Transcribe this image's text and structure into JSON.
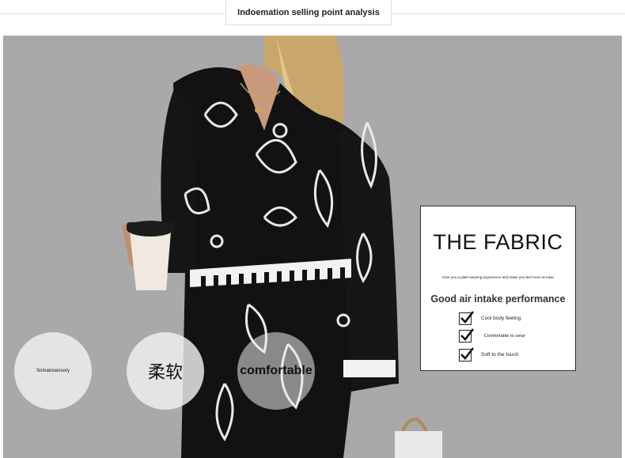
{
  "header": {
    "title": "Indoemation selling point analysis"
  },
  "photo": {
    "description_icon": "model-photo-image"
  },
  "features_circles": [
    {
      "label": "Somatosensory"
    },
    {
      "label": "柔软"
    },
    {
      "label": "comfortable"
    }
  ],
  "fabric_card": {
    "title": "THE FABRIC",
    "tagline": "Give you a plaid wearing experience and make you feel more at ease",
    "subtitle": "Good air intake performance",
    "features": [
      {
        "label": "Cool body feeling",
        "checked": true
      },
      {
        "label": "Comfortable to wear",
        "checked": true
      },
      {
        "label": "Soft to the touch",
        "checked": true
      }
    ]
  },
  "colors": {
    "background": "#a9a9a9",
    "garment": "#121212",
    "accent": "#ffffff"
  }
}
